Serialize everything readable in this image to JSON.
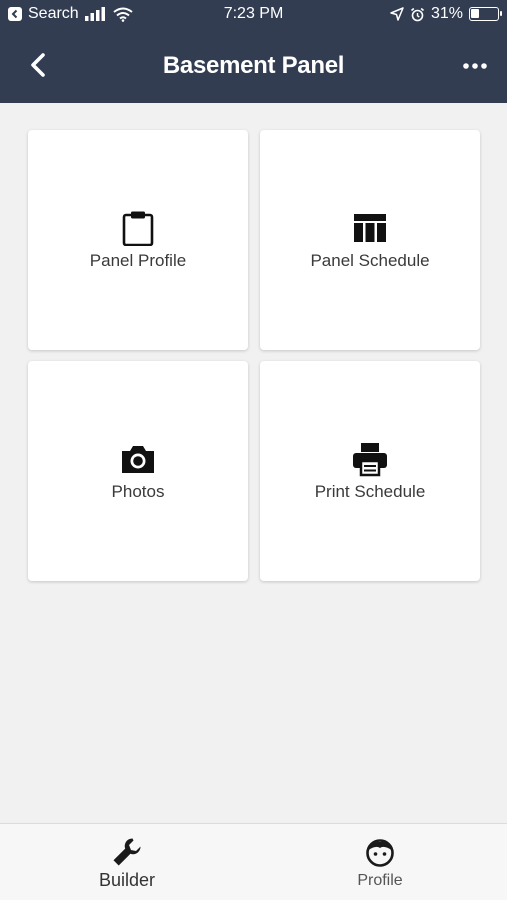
{
  "status_bar": {
    "back_app": "Search",
    "time": "7:23 PM",
    "battery": "31%",
    "battery_level": 0.31
  },
  "header": {
    "title": "Basement Panel"
  },
  "cards": [
    {
      "label": "Panel Profile",
      "icon": "clipboard-icon"
    },
    {
      "label": "Panel Schedule",
      "icon": "table-icon"
    },
    {
      "label": "Photos",
      "icon": "camera-icon"
    },
    {
      "label": "Print Schedule",
      "icon": "printer-icon"
    }
  ],
  "tabs": [
    {
      "label": "Builder",
      "icon": "wrench-icon",
      "active": true
    },
    {
      "label": "Profile",
      "icon": "face-icon",
      "active": false
    }
  ],
  "colors": {
    "header_bg": "#323d52",
    "page_bg": "#f1f1f1",
    "card_bg": "#ffffff"
  }
}
